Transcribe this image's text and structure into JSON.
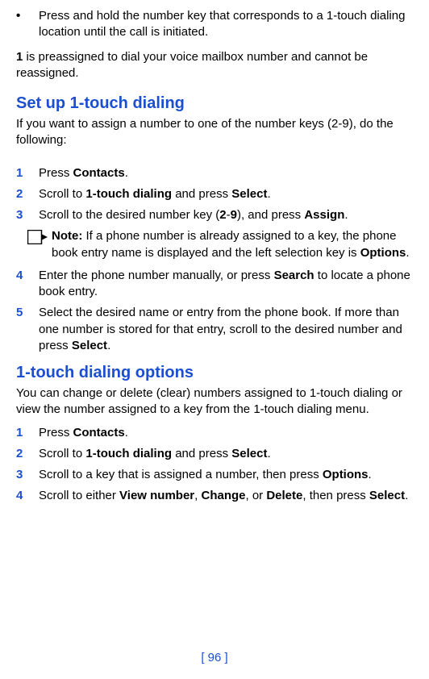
{
  "intro_bullet_mark": "•",
  "intro_bullet_text": "Press and hold the number key that corresponds to a 1-touch dialing location until the call is initiated.",
  "preassigned_prefix_bold": "1",
  "preassigned_rest": " is preassigned to dial your voice mailbox number and cannot be reassigned.",
  "setup_heading": "Set up 1-touch dialing",
  "setup_intro": "If you want to assign a number to one of the number keys (2-9), do the following:",
  "setup_steps": {
    "s1": {
      "num": "1",
      "a": "Press ",
      "b": "Contacts",
      "c": "."
    },
    "s2": {
      "num": "2",
      "a": "Scroll to ",
      "b": "1-touch dialing",
      "c": " and press ",
      "d": "Select",
      "e": "."
    },
    "s3": {
      "num": "3",
      "a": "Scroll to the desired number key (",
      "b": "2",
      "c": "-",
      "d": "9",
      "e": "), and press ",
      "f": "Assign",
      "g": "."
    },
    "note": {
      "label": "Note:  ",
      "a": "If a phone number is already assigned to a key, the phone book entry name is displayed and the left selection key is ",
      "b": "Options",
      "c": "."
    },
    "s4": {
      "num": "4",
      "a": "Enter the phone number manually, or press ",
      "b": "Search",
      "c": " to locate a phone book entry."
    },
    "s5": {
      "num": "5",
      "a": "Select the desired name or entry from the phone book. If more than one number is stored for that entry, scroll to the desired number and press ",
      "b": "Select",
      "c": "."
    }
  },
  "options_heading": "1-touch dialing options",
  "options_intro": "You can change or delete (clear) numbers assigned to 1-touch dialing or view the number assigned to a key from the 1-touch dialing menu.",
  "options_steps": {
    "s1": {
      "num": "1",
      "a": "Press ",
      "b": "Contacts",
      "c": "."
    },
    "s2": {
      "num": "2",
      "a": "Scroll to ",
      "b": "1-touch dialing",
      "c": " and press ",
      "d": "Select",
      "e": "."
    },
    "s3": {
      "num": "3",
      "a": "Scroll to a key that is assigned a number, then press ",
      "b": "Options",
      "c": "."
    },
    "s4": {
      "num": "4",
      "a": "Scroll to either ",
      "b": "View number",
      "c": ", ",
      "d": "Change",
      "e": ", or ",
      "f": "Delete",
      "g": ", then press ",
      "h": "Select",
      "i": "."
    }
  },
  "page_number": "[ 96 ]"
}
